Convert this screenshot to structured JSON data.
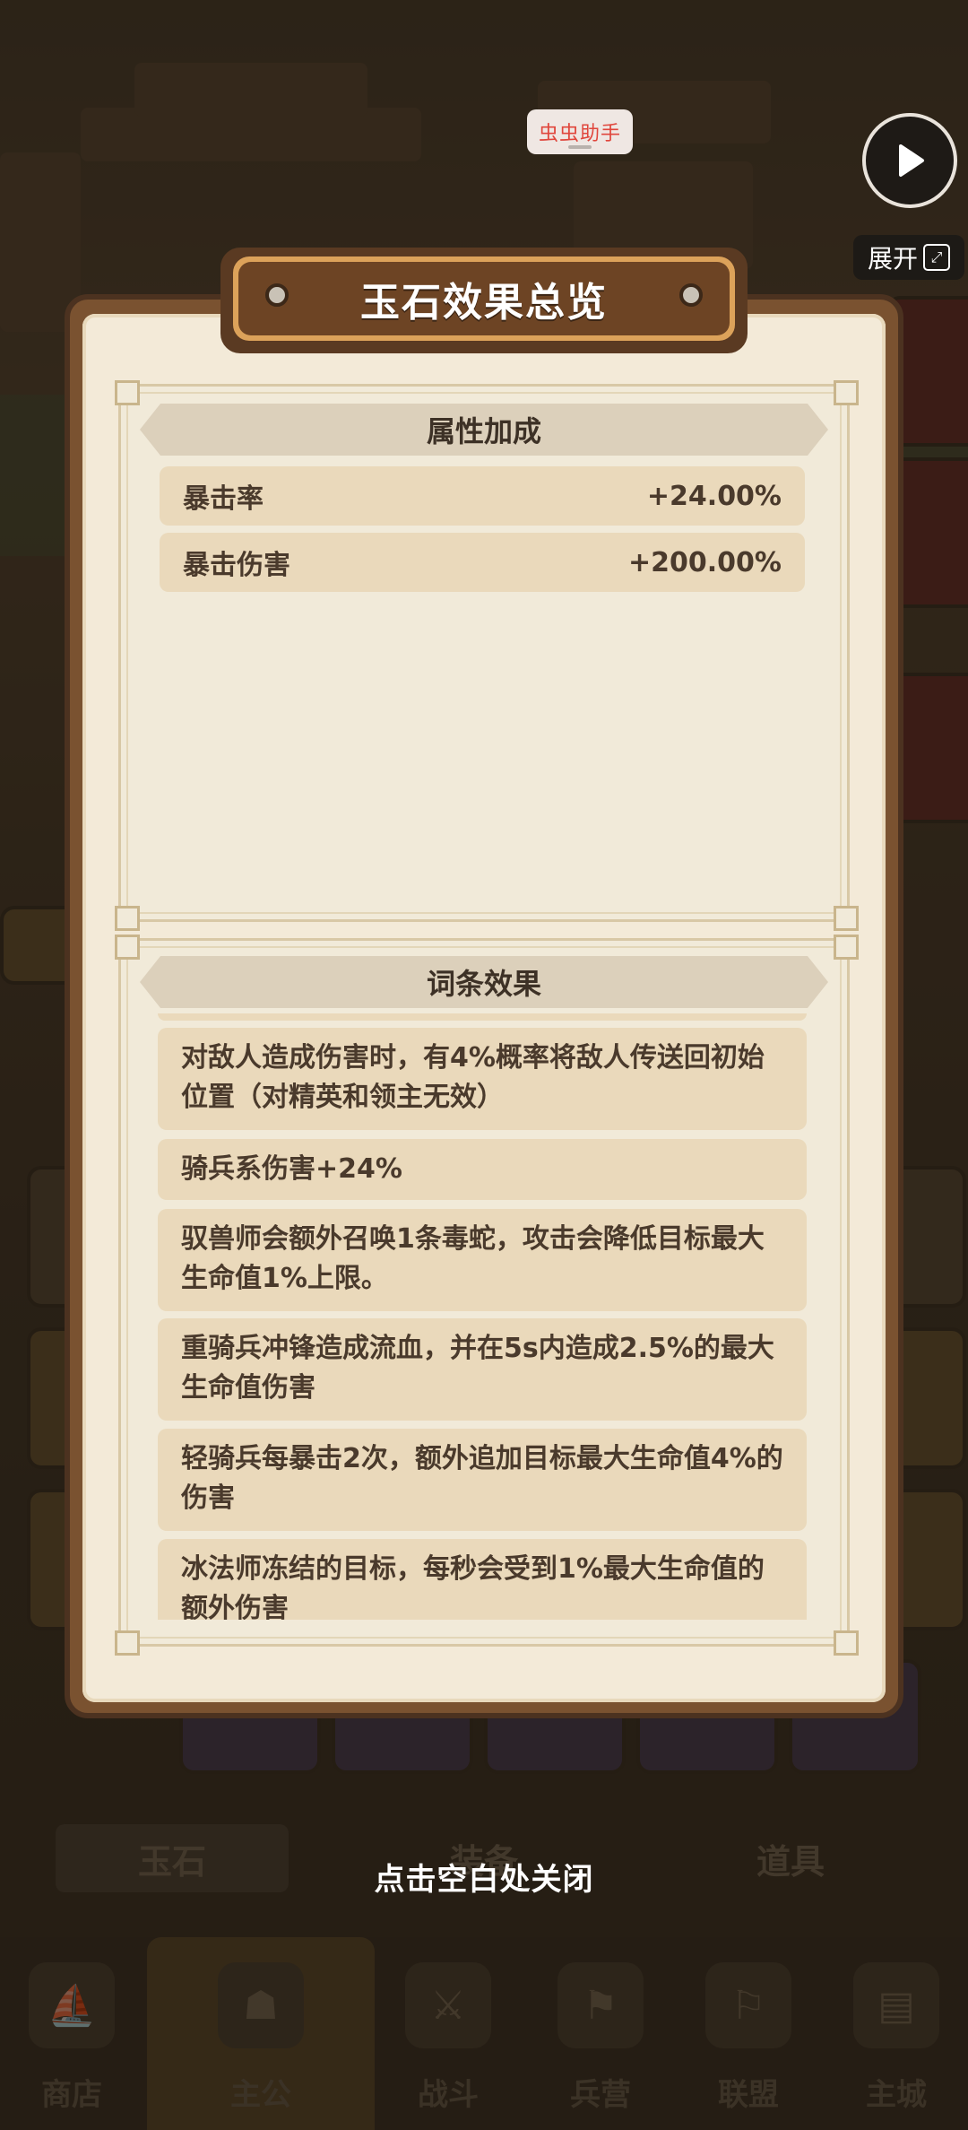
{
  "overlay": {
    "app_tag": "虫虫助手",
    "expand_label": "展开"
  },
  "panel": {
    "title": "玉石效果总览",
    "attributes_section": {
      "title": "属性加成",
      "rows": [
        {
          "name": "暴击率",
          "value": "+24.00%"
        },
        {
          "name": "暴击伤害",
          "value": "+200.00%"
        }
      ]
    },
    "effects_section": {
      "title": "词条效果",
      "items": [
        "对敌人造成伤害时，有4%概率将敌人传送回初始位置（对精英和领主无效）",
        "骑兵系伤害+24%",
        "驭兽师会额外召唤1条毒蛇，攻击会降低目标最大生命值1%上限。",
        "重骑兵冲锋造成流血，并在5s内造成2.5%的最大生命值伤害",
        "轻骑兵每暴击2次，额外追加目标最大生命值4%的伤害",
        "冰法师冻结的目标，每秒会受到1%最大生命值的额外伤害"
      ]
    },
    "close_hint": "点击空白处关闭"
  },
  "background": {
    "subtabs": [
      "玉石",
      "装备",
      "道具"
    ],
    "nav": [
      {
        "label": "商店",
        "icon": "shop-icon"
      },
      {
        "label": "主公",
        "icon": "lord-icon",
        "active": true
      },
      {
        "label": "战斗",
        "icon": "battle-icon"
      },
      {
        "label": "兵营",
        "icon": "barracks-icon"
      },
      {
        "label": "联盟",
        "icon": "alliance-icon"
      },
      {
        "label": "主城",
        "icon": "city-icon"
      }
    ]
  }
}
